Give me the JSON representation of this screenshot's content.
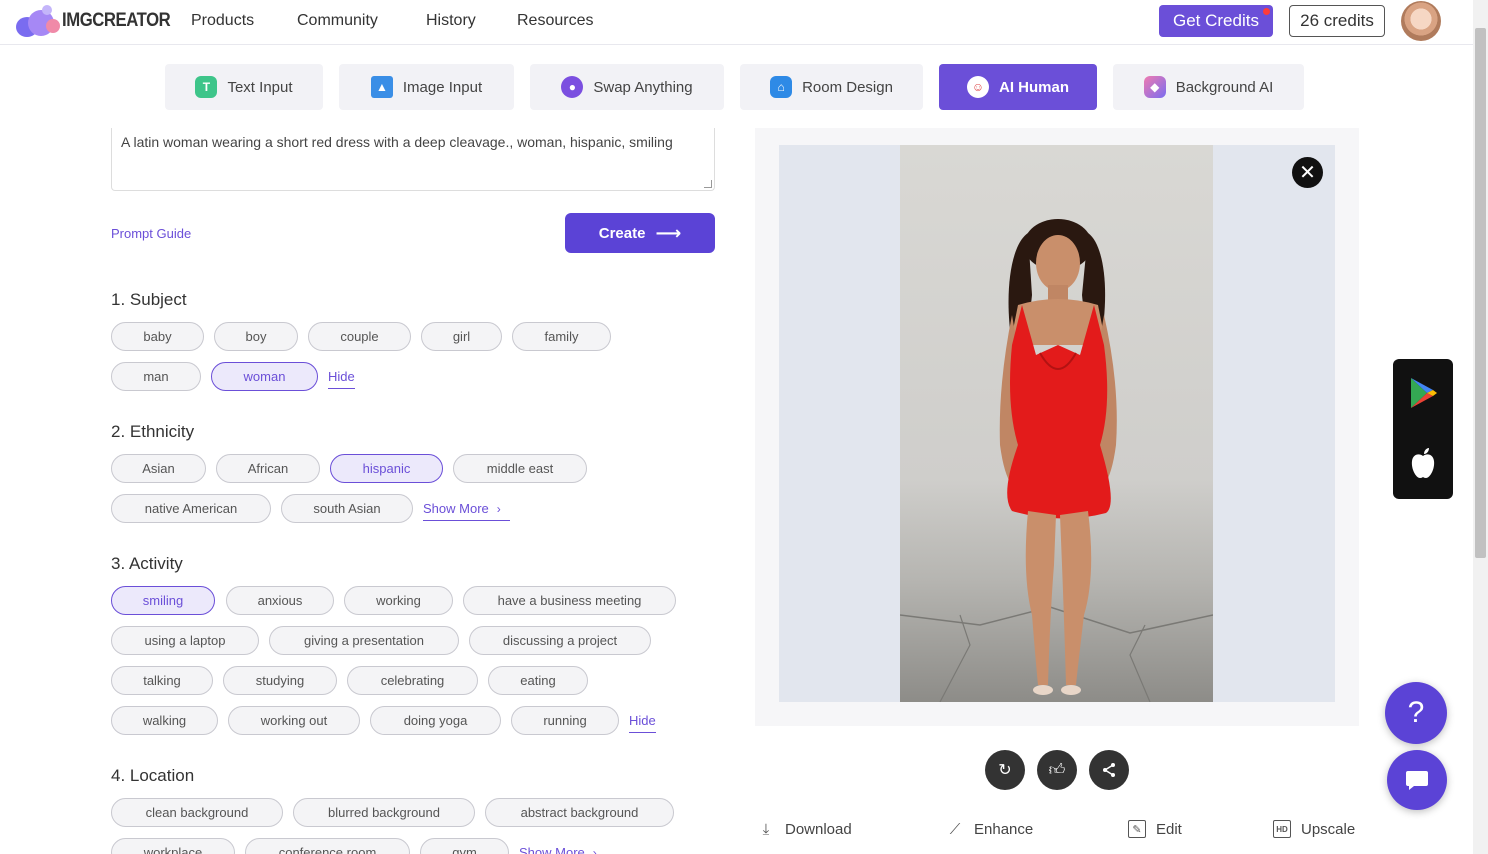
{
  "brand": {
    "name": "IMGCREATOR",
    "accent": "#6b4fd8"
  },
  "nav": {
    "items": [
      "Products",
      "Community",
      "History",
      "Resources"
    ]
  },
  "account": {
    "get_credits": "Get Credits",
    "credits": "26 credits"
  },
  "tool_tabs": [
    {
      "label": "Text Input",
      "icon": "text-icon"
    },
    {
      "label": "Image Input",
      "icon": "image-icon"
    },
    {
      "label": "Swap Anything",
      "icon": "palette-icon"
    },
    {
      "label": "Room Design",
      "icon": "house-icon"
    },
    {
      "label": "AI Human",
      "icon": "person-icon",
      "active": true
    },
    {
      "label": "Background AI",
      "icon": "background-icon"
    }
  ],
  "prompt": {
    "text": "A latin woman wearing a short red dress with a deep cleavage., woman, hispanic, smiling",
    "guide_label": "Prompt Guide",
    "create_label": "Create"
  },
  "sections": {
    "subject": {
      "title": "1. Subject",
      "chips": [
        "baby",
        "boy",
        "couple",
        "girl",
        "family",
        "man",
        "woman"
      ],
      "selected": "woman",
      "toggle": "Hide"
    },
    "ethnicity": {
      "title": "2. Ethnicity",
      "chips": [
        "Asian",
        "African",
        "hispanic",
        "middle east",
        "native American",
        "south Asian"
      ],
      "selected": "hispanic",
      "toggle": "Show More"
    },
    "activity": {
      "title": "3. Activity",
      "chips": [
        "smiling",
        "anxious",
        "working",
        "have a business meeting",
        "using a laptop",
        "giving a presentation",
        "discussing a project",
        "talking",
        "studying",
        "celebrating",
        "eating",
        "walking",
        "working out",
        "doing yoga",
        "running"
      ],
      "selected": "smiling",
      "toggle": "Hide"
    },
    "location": {
      "title": "4. Location",
      "chips": [
        "clean background",
        "blurred background",
        "abstract background",
        "workplace",
        "conference room",
        "gym"
      ],
      "toggle": "Show More"
    }
  },
  "preview": {
    "actions": [
      "Download",
      "Enhance",
      "Edit",
      "Upscale"
    ],
    "action_icons": [
      "download-icon",
      "wand-icon",
      "edit-icon",
      "hd-icon"
    ]
  }
}
